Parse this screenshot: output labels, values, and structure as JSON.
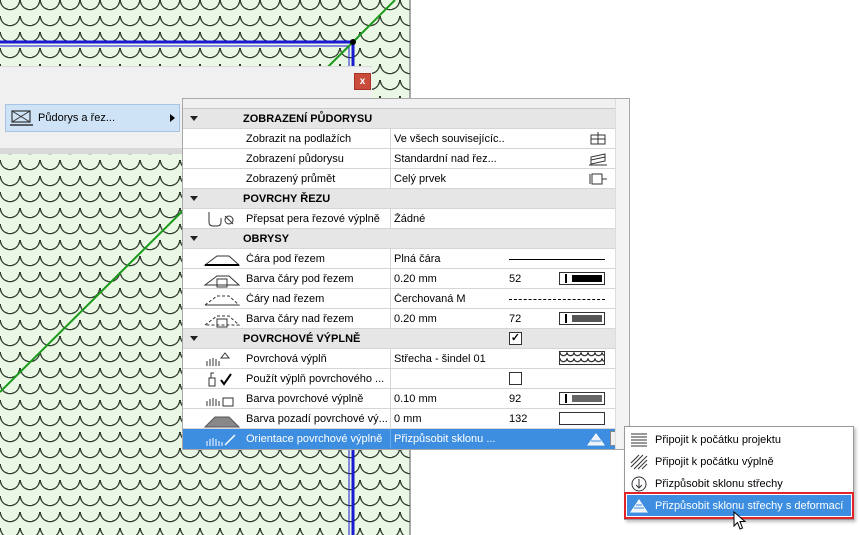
{
  "colors": {
    "accent": "#3d8ee0",
    "highlight_border": "#e2232a",
    "plan_fill": "#eaf7e4",
    "wall": "#1a1ad0",
    "ridge": "#1a9a1a"
  },
  "dialog": {
    "close_label": "x",
    "nav": {
      "label": "Půdorys a řez...",
      "icon": "floor-plan-section-icon"
    }
  },
  "sections": [
    {
      "title": "ZOBRAZENÍ PŮDORYSU",
      "rows": [
        {
          "label": "Zobrazit na podlažích",
          "value": "Ve všech souvisejícíc...",
          "icon": "stories-icon"
        },
        {
          "label": "Zobrazení půdorysu",
          "value": "Standardní nad řez...",
          "icon": "floor-plan-display-icon"
        },
        {
          "label": "Zobrazený průmět",
          "value": "Celý prvek",
          "icon": "projection-icon"
        }
      ]
    },
    {
      "title": "POVRCHY ŘEZU",
      "rows": [
        {
          "label": "Přepsat pera řezové výplně",
          "value": "Žádné",
          "icon": "override-pen-icon"
        }
      ]
    },
    {
      "title": "OBRYSY",
      "rows": [
        {
          "label": "Čára pod řezem",
          "value": "Plná čára",
          "icon": "line-below-icon"
        },
        {
          "label": "Barva čáry pod řezem",
          "value": "0.20 mm",
          "num": "52",
          "icon": "pen-below-icon"
        },
        {
          "label": "Čáry nad řezem",
          "value": "Čerchovaná M",
          "icon": "line-above-icon"
        },
        {
          "label": "Barva čáry nad řezem",
          "value": "0.20 mm",
          "num": "72",
          "icon": "pen-above-icon"
        }
      ]
    },
    {
      "title": "POVRCHOVÉ VÝPLNĚ",
      "checked": true,
      "rows": [
        {
          "label": "Povrchová výplň",
          "value": "Střecha - šindel 01",
          "icon": "cover-fill-icon"
        },
        {
          "label": "Použít výplň povrchového ...",
          "value": "",
          "checked": false,
          "icon": "use-fill-icon"
        },
        {
          "label": "Barva povrchové výplně",
          "value": "0.10 mm",
          "num": "92",
          "icon": "fill-pen-icon"
        },
        {
          "label": "Barva pozadí povrchové vý...",
          "value": "0 mm",
          "num": "132",
          "icon": "fill-background-icon"
        },
        {
          "label": "Orientace povrchové výplně",
          "value": "Přizpůsobit sklonu ...",
          "icon": "fill-orientation-icon",
          "selected": true
        }
      ]
    }
  ],
  "flyout": [
    {
      "label": "Připojit k počátku projektu",
      "icon": "project-origin-icon"
    },
    {
      "label": "Připojit k počátku výplně",
      "icon": "fill-origin-icon"
    },
    {
      "label": "Přizpůsobit sklonu střechy",
      "icon": "roof-slope-icon"
    },
    {
      "label": "Přizpůsobit sklonu střechy s deformací",
      "icon": "roof-slope-distorted-icon",
      "active": true
    }
  ]
}
